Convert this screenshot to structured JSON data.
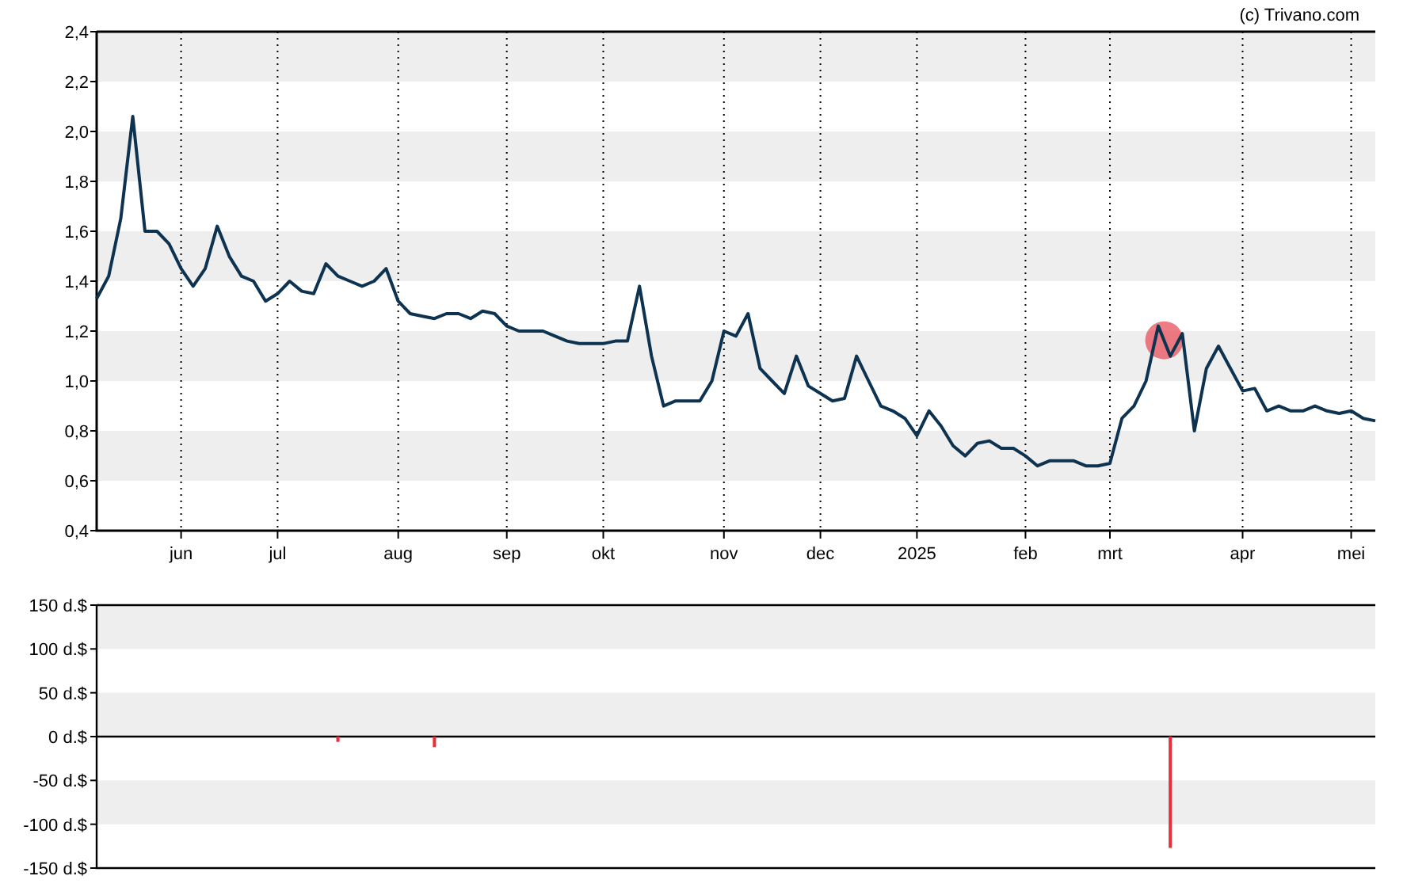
{
  "credit": "(c) Trivano.com",
  "price_chart": {
    "chart_data": {
      "type": "line",
      "grid": true,
      "ylim": [
        0.4,
        2.4
      ],
      "yticks": [
        {
          "value": 0.4,
          "label": "0,4"
        },
        {
          "value": 0.6,
          "label": "0,6"
        },
        {
          "value": 0.8,
          "label": "0,8"
        },
        {
          "value": 1.0,
          "label": "1,0"
        },
        {
          "value": 1.2,
          "label": "1,2"
        },
        {
          "value": 1.4,
          "label": "1,4"
        },
        {
          "value": 1.6,
          "label": "1,6"
        },
        {
          "value": 1.8,
          "label": "1,8"
        },
        {
          "value": 2.0,
          "label": "2,0"
        },
        {
          "value": 2.2,
          "label": "2,2"
        },
        {
          "value": 2.4,
          "label": "2,4"
        }
      ],
      "categories": [
        null,
        null,
        null,
        null,
        null,
        null,
        null,
        "jun",
        null,
        null,
        null,
        null,
        null,
        null,
        null,
        "jul",
        null,
        null,
        null,
        null,
        null,
        null,
        null,
        null,
        null,
        "aug",
        null,
        null,
        null,
        null,
        null,
        null,
        null,
        null,
        "sep",
        null,
        null,
        null,
        null,
        null,
        null,
        null,
        "okt",
        null,
        null,
        null,
        null,
        null,
        null,
        null,
        null,
        null,
        "nov",
        null,
        null,
        null,
        null,
        null,
        null,
        null,
        "dec",
        null,
        null,
        null,
        null,
        null,
        null,
        null,
        "2025",
        null,
        null,
        null,
        null,
        null,
        null,
        null,
        null,
        "feb",
        null,
        null,
        null,
        null,
        null,
        null,
        "mrt",
        null,
        null,
        null,
        null,
        null,
        null,
        null,
        null,
        null,
        null,
        "apr",
        null,
        null,
        null,
        null,
        null,
        null,
        null,
        null,
        "mei",
        null,
        null
      ],
      "series": [
        {
          "color": "#0d3350",
          "values": [
            1.33,
            1.42,
            1.65,
            2.06,
            1.6,
            1.6,
            1.55,
            1.45,
            1.38,
            1.45,
            1.62,
            1.5,
            1.42,
            1.4,
            1.32,
            1.35,
            1.4,
            1.36,
            1.35,
            1.47,
            1.42,
            1.4,
            1.38,
            1.4,
            1.45,
            1.32,
            1.27,
            1.26,
            1.25,
            1.27,
            1.27,
            1.25,
            1.28,
            1.27,
            1.22,
            1.2,
            1.2,
            1.2,
            1.18,
            1.16,
            1.15,
            1.15,
            1.15,
            1.16,
            1.16,
            1.38,
            1.1,
            0.9,
            0.92,
            0.92,
            0.92,
            1.0,
            1.2,
            1.18,
            1.27,
            1.05,
            1.0,
            0.95,
            1.1,
            0.98,
            0.95,
            0.92,
            0.93,
            1.1,
            1.0,
            0.9,
            0.88,
            0.85,
            0.78,
            0.88,
            0.82,
            0.74,
            0.7,
            0.75,
            0.76,
            0.73,
            0.73,
            0.7,
            0.66,
            0.68,
            0.68,
            0.68,
            0.66,
            0.66,
            0.67,
            0.85,
            0.9,
            1.0,
            1.22,
            1.1,
            1.19,
            0.8,
            1.05,
            1.14,
            1.05,
            0.96,
            0.97,
            0.88,
            0.9,
            0.88,
            0.88,
            0.9,
            0.88,
            0.87,
            0.88,
            0.85,
            0.84
          ]
        }
      ],
      "marker": {
        "kind": "circle"
      }
    }
  },
  "dividend_chart": {
    "chart_data": {
      "type": "bar",
      "ylim": [
        -150,
        150
      ],
      "yticks": [
        {
          "value": 150,
          "label": "150 d.$"
        },
        {
          "value": 100,
          "label": "100 d.$"
        },
        {
          "value": 50,
          "label": "50 d.$"
        },
        {
          "value": 0,
          "label": "0 d.$"
        },
        {
          "value": -50,
          "label": "-50 d.$"
        },
        {
          "value": -100,
          "label": "-100 d.$"
        },
        {
          "value": -150,
          "label": "-150 d.$"
        }
      ],
      "categories": [
        null,
        null,
        null,
        null,
        null,
        null,
        null,
        null,
        null,
        null,
        null,
        null,
        null,
        null,
        null,
        null,
        null,
        null,
        null,
        null,
        null,
        null,
        null,
        null,
        null,
        null,
        null,
        null,
        null,
        null,
        null,
        null,
        null,
        null,
        null,
        null,
        null,
        null,
        null,
        null,
        null,
        null,
        null,
        null,
        null,
        null,
        null,
        null,
        null,
        null,
        null,
        null,
        null,
        null,
        null,
        null,
        null,
        null,
        null,
        null,
        null,
        null,
        null,
        null,
        null,
        null,
        null,
        null,
        null,
        null,
        null,
        null,
        null,
        null,
        null,
        null,
        null,
        null,
        null,
        null,
        null,
        null,
        null,
        null,
        null,
        null,
        null,
        null,
        null,
        null,
        null,
        null,
        null,
        null,
        null,
        null,
        null,
        null,
        null,
        null,
        null,
        null,
        null,
        null,
        null,
        null,
        null
      ],
      "series": [
        {
          "color": "#e8303b",
          "values": [
            null,
            null,
            null,
            null,
            null,
            null,
            null,
            null,
            null,
            null,
            null,
            null,
            null,
            null,
            null,
            null,
            null,
            null,
            null,
            null,
            -6,
            null,
            null,
            null,
            null,
            null,
            null,
            null,
            -12,
            null,
            null,
            null,
            null,
            null,
            null,
            null,
            null,
            null,
            null,
            null,
            null,
            null,
            null,
            null,
            null,
            null,
            null,
            null,
            null,
            null,
            null,
            null,
            null,
            null,
            null,
            null,
            null,
            null,
            null,
            null,
            null,
            null,
            null,
            null,
            null,
            null,
            null,
            null,
            null,
            null,
            null,
            null,
            null,
            null,
            null,
            null,
            null,
            null,
            null,
            null,
            null,
            null,
            null,
            null,
            null,
            null,
            null,
            null,
            null,
            -127,
            null,
            null,
            null,
            null,
            null,
            null,
            null,
            null,
            null,
            null,
            null,
            null,
            null,
            null,
            null,
            null,
            null
          ]
        }
      ]
    }
  }
}
